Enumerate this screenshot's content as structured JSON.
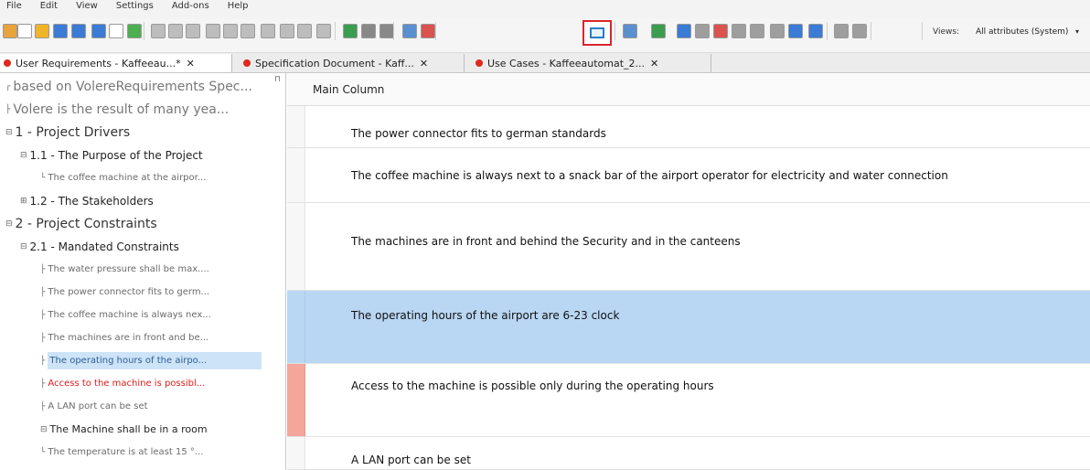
{
  "menu": [
    "File",
    "Edit",
    "View",
    "Settings",
    "Add-ons",
    "Help"
  ],
  "toolbar": {
    "views_label": "Views:",
    "views_value": "All attributes (System)",
    "views_arrow": "▾",
    "icons": [
      "new-folder-icon",
      "new-doc-icon",
      "open-folder-icon",
      "save-icon",
      "save-all-icon",
      "pen-icon",
      "checkbox-empty-icon",
      "checkbox-checked-icon",
      "bold-icon",
      "italic-icon",
      "underline-icon",
      "superscript-icon",
      "subscript-icon",
      "strikethrough-icon",
      "font-color-icon",
      "bullet-list-icon",
      "numbered-list-icon",
      "table-icon",
      "filter-icon",
      "filter-clear-icon",
      "filter-edit-icon",
      "column-icon",
      "search-replace-icon",
      "row-layout-icon",
      "add-row-icon",
      "link-icon",
      "doc-icon",
      "split-icon",
      "wrap-icon",
      "export-icon",
      "attach-icon",
      "zoom-icon",
      "image-icon",
      "compare-icon",
      "compare2-icon"
    ]
  },
  "tabs": [
    {
      "label": "User Requirements - Kaffeeau...*",
      "close": "✕"
    },
    {
      "label": "Specification Document - Kaff...",
      "close": "✕"
    },
    {
      "label": "Use Cases - Kaffeeautomat_2...",
      "close": "✕"
    }
  ],
  "tree": {
    "pin": "⊓",
    "items": [
      {
        "text": "based on VolereRequirements Spec...",
        "cls": "t-l0 dim",
        "prefix": "┌"
      },
      {
        "text": "Volere is the result of many yea...",
        "cls": "t-l0 dim",
        "prefix": "├"
      },
      {
        "text": "1 - Project Drivers",
        "cls": "t-l0",
        "prefix": "⊟"
      },
      {
        "text": "1.1 - The Purpose of the Project",
        "cls": "t-l1",
        "prefix": "⊟"
      },
      {
        "text": "The coffee machine at the airpor...",
        "cls": "t-l3",
        "prefix": "└"
      },
      {
        "text": "1.2 - The Stakeholders",
        "cls": "t-l1",
        "prefix": "⊞"
      },
      {
        "text": "2 - Project Constraints",
        "cls": "t-l0",
        "prefix": "⊟"
      },
      {
        "text": "2.1 - Mandated Constraints",
        "cls": "t-l1",
        "prefix": "⊟"
      },
      {
        "text": "The water pressure shall be max....",
        "cls": "t-l3",
        "prefix": "├"
      },
      {
        "text": "The power connector fits to germ...",
        "cls": "t-l3",
        "prefix": "├"
      },
      {
        "text": "The coffee machine is always nex...",
        "cls": "t-l3",
        "prefix": "├"
      },
      {
        "text": "The machines are in front and be...",
        "cls": "t-l3",
        "prefix": "├"
      },
      {
        "text": "The operating hours of the airpo...",
        "cls": "t-l3 sel",
        "prefix": "├"
      },
      {
        "text": "Access to the machine is possibl...",
        "cls": "t-l3 red",
        "prefix": "├"
      },
      {
        "text": "A LAN port can be set",
        "cls": "t-l3",
        "prefix": "├"
      },
      {
        "text": "The Machine shall be in a room",
        "cls": "t-l2",
        "prefix": "⊟"
      },
      {
        "text": "The temperature is at least 15 °...",
        "cls": "t-l3",
        "prefix": "└"
      }
    ]
  },
  "grid": {
    "header": "Main Column",
    "rows": [
      {
        "text": "The power connector fits to german standards"
      },
      {
        "text": "The coffee machine is always next to a snack bar of the airport operator for electricity and water connection"
      },
      {
        "text": "The machines are in front and behind the Security and in the canteens"
      },
      {
        "text": "The operating hours of the airport are 6-23 clock"
      },
      {
        "text": "Access to the machine is possible only during the operating hours"
      },
      {
        "text": "A LAN port can be set"
      }
    ]
  },
  "colors": {
    "selection": "#b9d6f3",
    "flag": "#f4a69a",
    "highlight_border": "#d9262b",
    "tab_dot": "#e0281f"
  }
}
